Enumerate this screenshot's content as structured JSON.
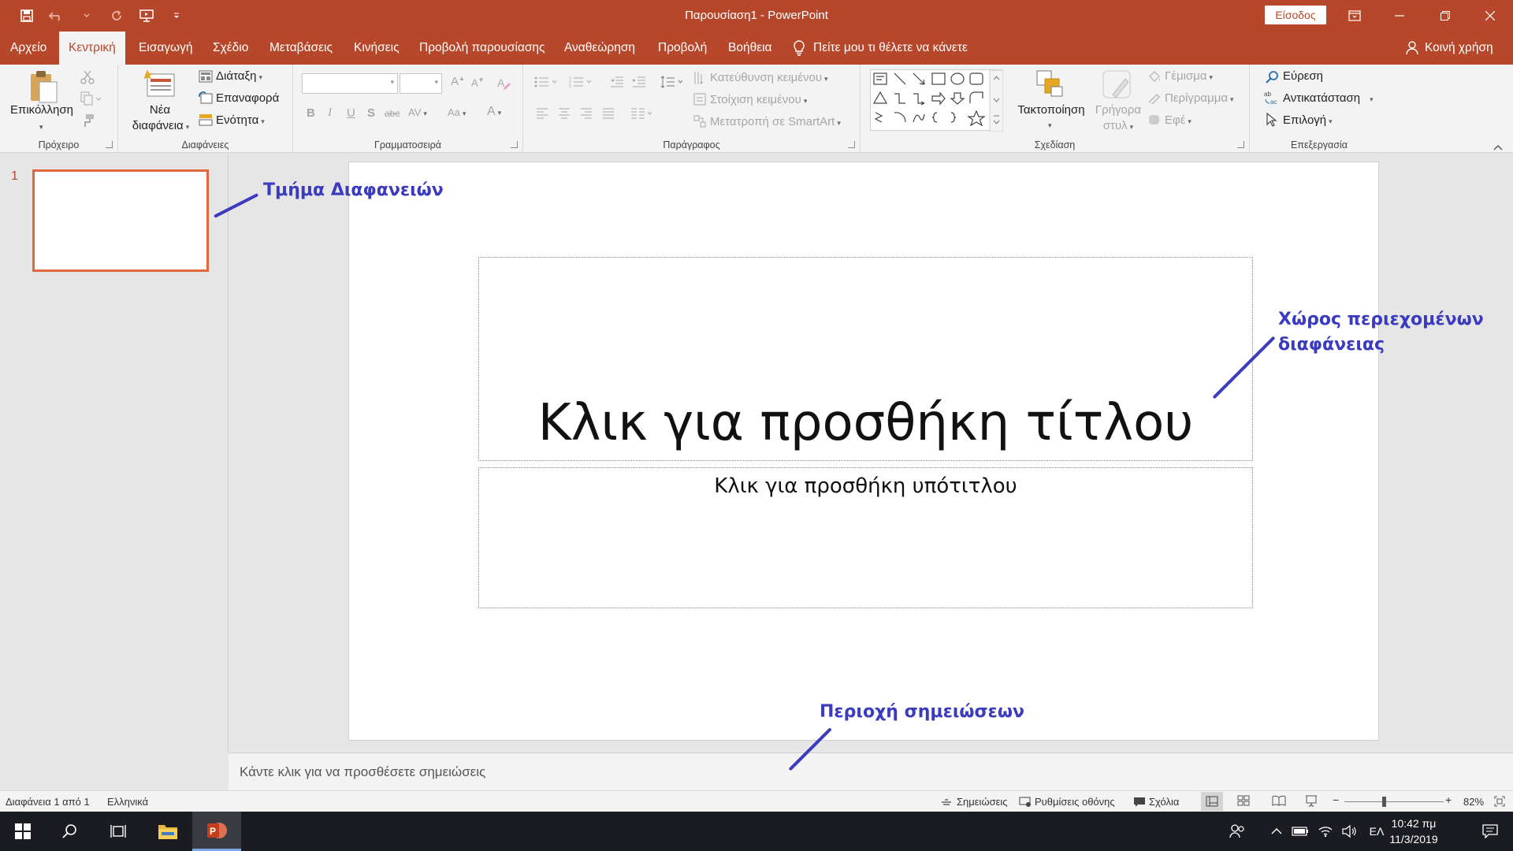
{
  "window": {
    "title": "Παρουσίαση1 - PowerPoint",
    "signin": "Είσοδος"
  },
  "tabs": [
    "Αρχείο",
    "Κεντρική",
    "Εισαγωγή",
    "Σχέδιο",
    "Μεταβάσεις",
    "Κινήσεις",
    "Προβολή παρουσίασης",
    "Αναθεώρηση",
    "Προβολή",
    "Βοήθεια"
  ],
  "active_tab": "Κεντρική",
  "tellme": "Πείτε μου τι θέλετε να κάνετε",
  "share": "Κοινή χρήση",
  "ribbon": {
    "clipboard": {
      "label": "Πρόχειρο",
      "paste": "Επικόλληση"
    },
    "slides": {
      "label": "Διαφάνειες",
      "new_slide_1": "Νέα",
      "new_slide_2": "διαφάνεια",
      "layout": "Διάταξη",
      "reset": "Επαναφορά",
      "section": "Ενότητα"
    },
    "font": {
      "label": "Γραμματοσειρά"
    },
    "paragraph": {
      "label": "Παράγραφος",
      "text_direction": "Κατεύθυνση κειμένου",
      "align_text": "Στοίχιση κειμένου",
      "smartart": "Μετατροπή σε SmartArt"
    },
    "drawing": {
      "label": "Σχεδίαση",
      "arrange": "Τακτοποίηση",
      "quick_styles_1": "Γρήγορα",
      "quick_styles_2": "στυλ",
      "fill": "Γέμισμα",
      "outline": "Περίγραμμα",
      "effects": "Εφέ"
    },
    "editing": {
      "label": "Επεξεργασία",
      "find": "Εύρεση",
      "replace": "Αντικατάσταση",
      "select": "Επιλογή"
    }
  },
  "thumbnails": {
    "number": "1"
  },
  "slide": {
    "title_placeholder": "Κλικ για προσθήκη τίτλου",
    "subtitle_placeholder": "Κλικ για προσθήκη υπότιτλου"
  },
  "notes_placeholder": "Κάντε κλικ για να προσθέσετε σημειώσεις",
  "annotations": {
    "slides_pane": "Τμήμα Διαφανειών",
    "content_area_1": "Χώρος περιεχομένων",
    "content_area_2": "διαφάνειας",
    "notes_area": "Περιοχή σημειώσεων"
  },
  "status": {
    "slide_count": "Διαφάνεια 1 από 1",
    "language": "Ελληνικά",
    "notes": "Σημειώσεις",
    "display": "Ρυθμίσεις οθόνης",
    "comments": "Σχόλια",
    "zoom": "82%",
    "zoom_level": 0.82
  },
  "taskbar": {
    "lang": "ΕΛ",
    "time": "10:42 πμ",
    "date": "11/3/2019"
  },
  "colors": {
    "accent": "#b7472a",
    "annotation": "#3b3bbf",
    "thumb_border": "#e1683d"
  }
}
